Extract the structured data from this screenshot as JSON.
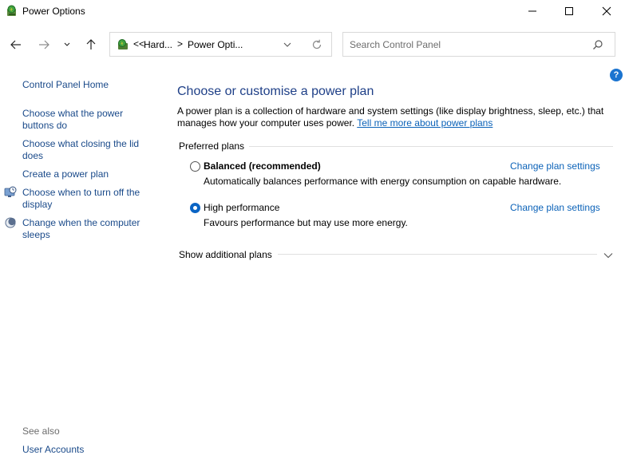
{
  "window": {
    "title": "Power Options"
  },
  "address": {
    "crumbs": [
      "Hard...",
      "Power Opti..."
    ],
    "back_prefix": "<<",
    "separator": ">"
  },
  "search": {
    "placeholder": "Search Control Panel"
  },
  "left_pane": {
    "home": "Control Panel Home",
    "links": [
      "Choose what the power buttons do",
      "Choose what closing the lid does",
      "Create a power plan",
      "Choose when to turn off the display",
      "Change when the computer sleeps"
    ],
    "see_also_label": "See also",
    "see_also_links": [
      "User Accounts"
    ]
  },
  "help": {
    "label": "?"
  },
  "main": {
    "title": "Choose or customise a power plan",
    "description": "A power plan is a collection of hardware and system settings (like display brightness, sleep, etc.) that manages how your computer uses power.",
    "learn_more": "Tell me more about power plans",
    "preferred_label": "Preferred plans",
    "plans": [
      {
        "name": "Balanced (recommended)",
        "description": "Automatically balances performance with energy consumption on capable hardware.",
        "link": "Change plan settings",
        "selected": false
      },
      {
        "name": "High performance",
        "description": "Favours performance but may use more energy.",
        "link": "Change plan settings",
        "selected": true
      }
    ],
    "show_additional": "Show additional plans"
  },
  "icons": {
    "app": "power-options-icon",
    "back": "arrow-left-icon",
    "forward": "arrow-right-icon",
    "recent": "chevron-down-icon",
    "up": "arrow-up-icon",
    "refresh": "refresh-icon",
    "search": "search-icon"
  },
  "colors": {
    "link": "#1a4a8a",
    "title": "#1e3f87",
    "accent": "#0a64c4",
    "help": "#1b74d0"
  }
}
